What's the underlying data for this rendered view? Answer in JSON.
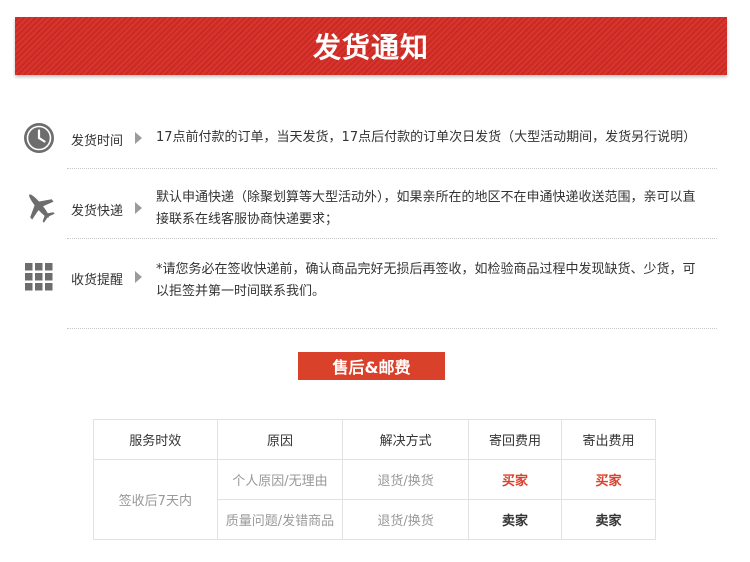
{
  "banner": {
    "title": "发货通知"
  },
  "rows": [
    {
      "icon": "clock-icon",
      "label": "发货时间",
      "text": "17点前付款的订单，当天发货，17点后付款的订单次日发货（大型活动期间，发货另行说明）"
    },
    {
      "icon": "airplane-icon",
      "label": "发货快递",
      "text": "默认申通快递（除聚划算等大型活动外），如果亲所在的地区不在申通快递收送范围，亲可以直接联系在线客服协商快递要求；"
    },
    {
      "icon": "grid-icon",
      "label": "收货提醒",
      "text": "*请您务必在签收快递前，确认商品完好无损后再签收，如检验商品过程中发现缺货、少货，可以拒签并第一时间联系我们。"
    }
  ],
  "after_sales": {
    "title": "售后&邮费"
  },
  "table": {
    "headers": [
      "服务时效",
      "原因",
      "解决方式",
      "寄回费用",
      "寄出费用"
    ],
    "service_period": "签收后7天内",
    "rows": [
      {
        "reason": "个人原因/无理由",
        "solution": "退货/换货",
        "return_fee": "买家",
        "send_fee": "买家"
      },
      {
        "reason": "质量问题/发错商品",
        "solution": "退货/换货",
        "return_fee": "卖家",
        "send_fee": "卖家"
      }
    ]
  },
  "colors": {
    "banner_red": "#d7352e",
    "accent_red": "#d9412b",
    "icon_gray": "#6d6d6d"
  }
}
